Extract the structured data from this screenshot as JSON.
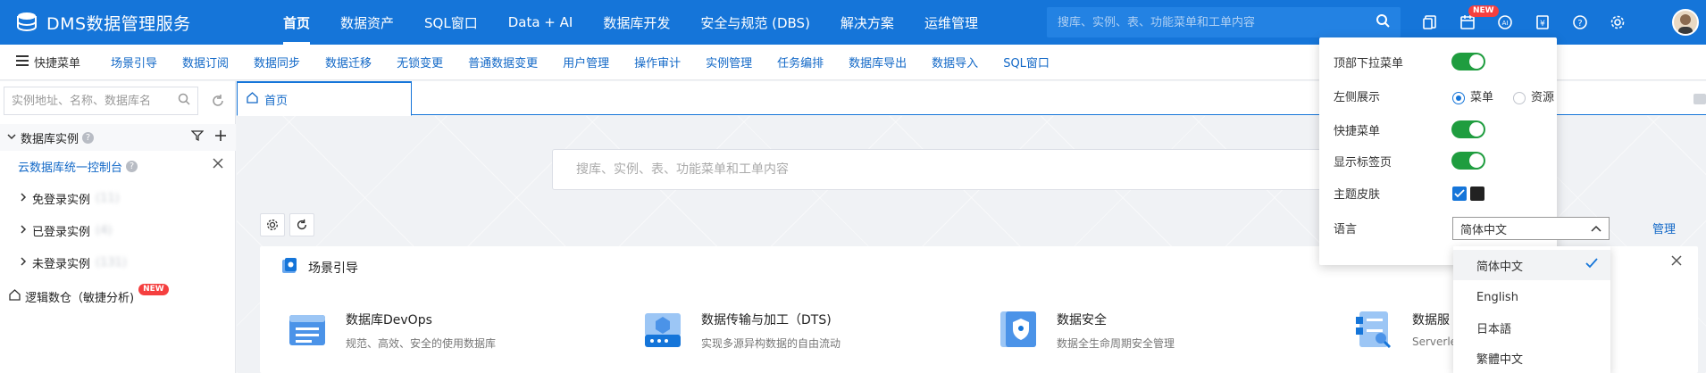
{
  "header": {
    "app_name": "DMS数据管理服务",
    "nav": [
      "首页",
      "数据资产",
      "SQL窗口",
      "Data + AI",
      "数据库开发",
      "安全与规范 (DBS)",
      "解决方案",
      "运维管理"
    ],
    "active_nav": "首页",
    "search_placeholder": "搜库、实例、表、功能菜单和工单内容",
    "new_badge": "NEW",
    "icons": [
      "copy-icon",
      "calendar-icon",
      "ai-assistant-icon",
      "billing-icon",
      "help-icon",
      "settings-gear-icon"
    ]
  },
  "quick_menu": {
    "label": "快捷菜单",
    "items": [
      "场景引导",
      "数据订阅",
      "数据同步",
      "数据迁移",
      "无锁变更",
      "普通数据变更",
      "用户管理",
      "操作审计",
      "实例管理",
      "任务编排",
      "数据库导出",
      "数据导入",
      "SQL窗口"
    ]
  },
  "sidebar": {
    "search_placeholder": "实例地址、名称、数据库名",
    "tree_title": "数据库实例",
    "cloud_console": "云数据库统一控制台",
    "items": [
      "免登录实例",
      "已登录实例",
      "未登录实例"
    ],
    "blurred_counts": [
      "(11)",
      "(4)",
      "(131)"
    ],
    "logic": "逻辑数仓（敏捷分析)",
    "logic_badge": "NEW"
  },
  "tabs": {
    "home": "首页"
  },
  "main": {
    "search_placeholder": "搜库、实例、表、功能菜单和工单内容",
    "manage_link": "管理",
    "guide_title": "场景引导",
    "features": [
      {
        "name": "数据库DevOps",
        "desc": "规范、高效、安全的使用数据库"
      },
      {
        "name": "数据传输与加工（DTS)",
        "desc": "实现多源异构数据的自由流动"
      },
      {
        "name": "数据安全",
        "desc": "数据全生命周期安全管理"
      },
      {
        "name": "数据服",
        "desc": "Serverle"
      }
    ]
  },
  "settings": {
    "top_menu": "顶部下拉菜单",
    "left_display": "左侧展示",
    "left_options": [
      "菜单",
      "资源"
    ],
    "left_selected": "菜单",
    "quick_menu": "快捷菜单",
    "show_tabs": "显示标签页",
    "theme": "主题皮肤",
    "theme_colors": [
      "#1575d9",
      "#222222"
    ],
    "language": "语言",
    "language_value": "简体中文",
    "language_options": [
      "简体中文",
      "English",
      "日本語",
      "繁體中文"
    ],
    "toggles": {
      "top_menu": true,
      "quick_menu": true,
      "show_tabs": true
    }
  },
  "colors": {
    "brand": "#1575d9",
    "toggle_on": "#1f9d3f",
    "link": "#1268c7"
  }
}
